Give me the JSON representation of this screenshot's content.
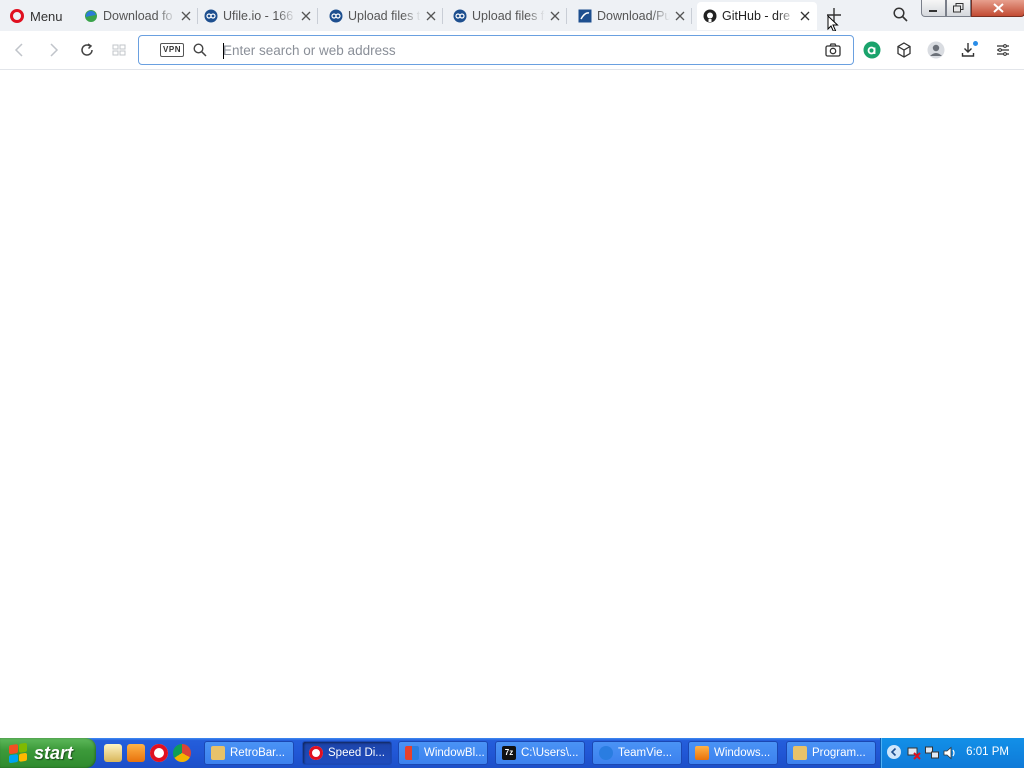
{
  "browser": {
    "menu_label": "Menu",
    "tabs": [
      {
        "title": "Download fo",
        "icon": "edge-icon"
      },
      {
        "title": "Ufile.io - 166",
        "icon": "ufile-icon"
      },
      {
        "title": "Upload files t",
        "icon": "ufile-icon"
      },
      {
        "title": "Upload files f",
        "icon": "ufile-icon"
      },
      {
        "title": "Download/Pu",
        "icon": "site-icon"
      },
      {
        "title": "GitHub - dre",
        "icon": "github-icon",
        "active": true
      }
    ],
    "address": {
      "vpn_label": "VPN",
      "placeholder": "Enter search or web address",
      "value": ""
    }
  },
  "taskbar": {
    "start_label": "start",
    "tasks": [
      {
        "label": "RetroBar...",
        "icon_color": "#e8c26a"
      },
      {
        "label": "Speed Di...",
        "icon_color": "#e01020",
        "active": true
      },
      {
        "label": "WindowBl...",
        "icon_color": "#f2a531"
      },
      {
        "label": "C:\\Users\\...",
        "icon_color": "#111111"
      },
      {
        "label": "TeamVie...",
        "icon_color": "#2a7de1"
      },
      {
        "label": "Windows...",
        "icon_color": "#f08a24"
      },
      {
        "label": "Program...",
        "icon_color": "#e8c26a"
      }
    ],
    "clock": "6:01 PM"
  },
  "colors": {
    "accent": "#6aa0e0",
    "opera_red": "#e01020",
    "xp_blue": "#245edb",
    "xp_green": "#3c9a3a"
  }
}
